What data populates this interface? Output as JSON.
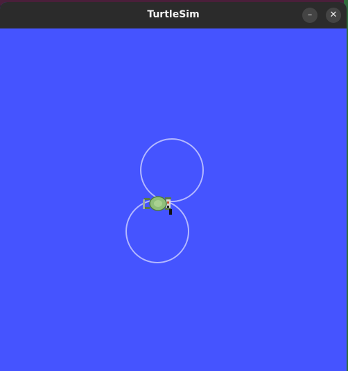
{
  "window": {
    "title": "TurtleSim",
    "minimize_glyph": "–",
    "close_glyph": "✕",
    "titlebar_color": "#2b2b2b",
    "background_color": "#4554ff"
  },
  "canvas": {
    "pen_color": "#b3b8ff",
    "turtle": {
      "icon": "turtle-icon",
      "shell_color": "#8fbf7a"
    }
  }
}
